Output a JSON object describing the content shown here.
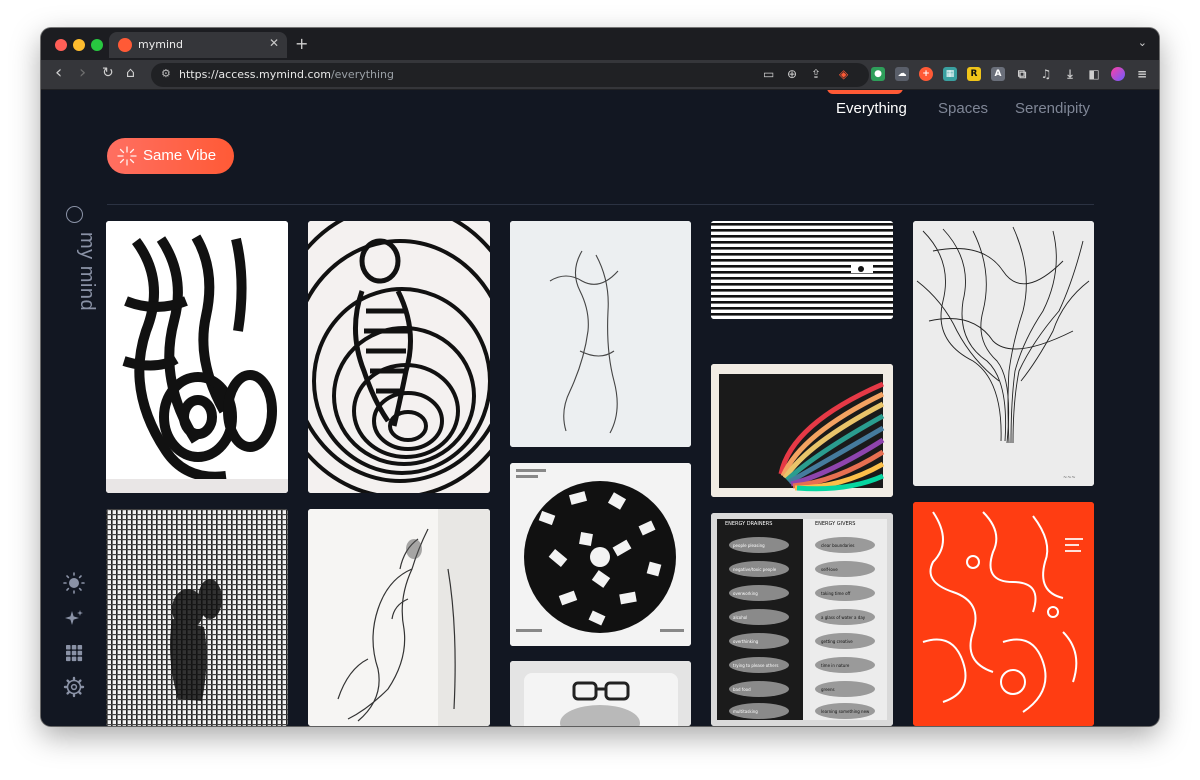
{
  "browser": {
    "tab_title": "mymind",
    "tab_close": "✕",
    "new_tab": "+",
    "tab_menu": "⌄",
    "url_host": "https://access.mymind.com",
    "url_path": "/everything",
    "nav": {
      "back": "‹",
      "forward": "›",
      "reload": "↻",
      "home": "⌂"
    }
  },
  "topnav": {
    "items": [
      "Everything",
      "Spaces",
      "Serendipity"
    ],
    "active": "Everything"
  },
  "vibe_button": {
    "label": "Same Vibe"
  },
  "logo": {
    "text": "my mind"
  },
  "sidebar_icons": [
    "sun-icon",
    "sparkles-icon",
    "grid-icon",
    "gear-icon"
  ],
  "colors": {
    "background": "#121722",
    "accent": "#ff5a36",
    "active_nav": "#ffffff",
    "inactive_nav": "#7f8696",
    "divider": "#2b3242"
  },
  "cards": {
    "poster": {
      "left_header": "ENERGY DRAINERS",
      "right_header": "ENERGY GIVERS",
      "drainers": [
        "people pleasing",
        "negative/toxic people",
        "overworking",
        "alcohol",
        "overthinking",
        "trying to please others",
        "bad food",
        "multitasking"
      ],
      "givers": [
        "clear boundaries",
        "self-love",
        "taking time off",
        "a glass of water a day",
        "getting creative",
        "time in nature",
        "greens",
        "learning something new"
      ]
    }
  }
}
